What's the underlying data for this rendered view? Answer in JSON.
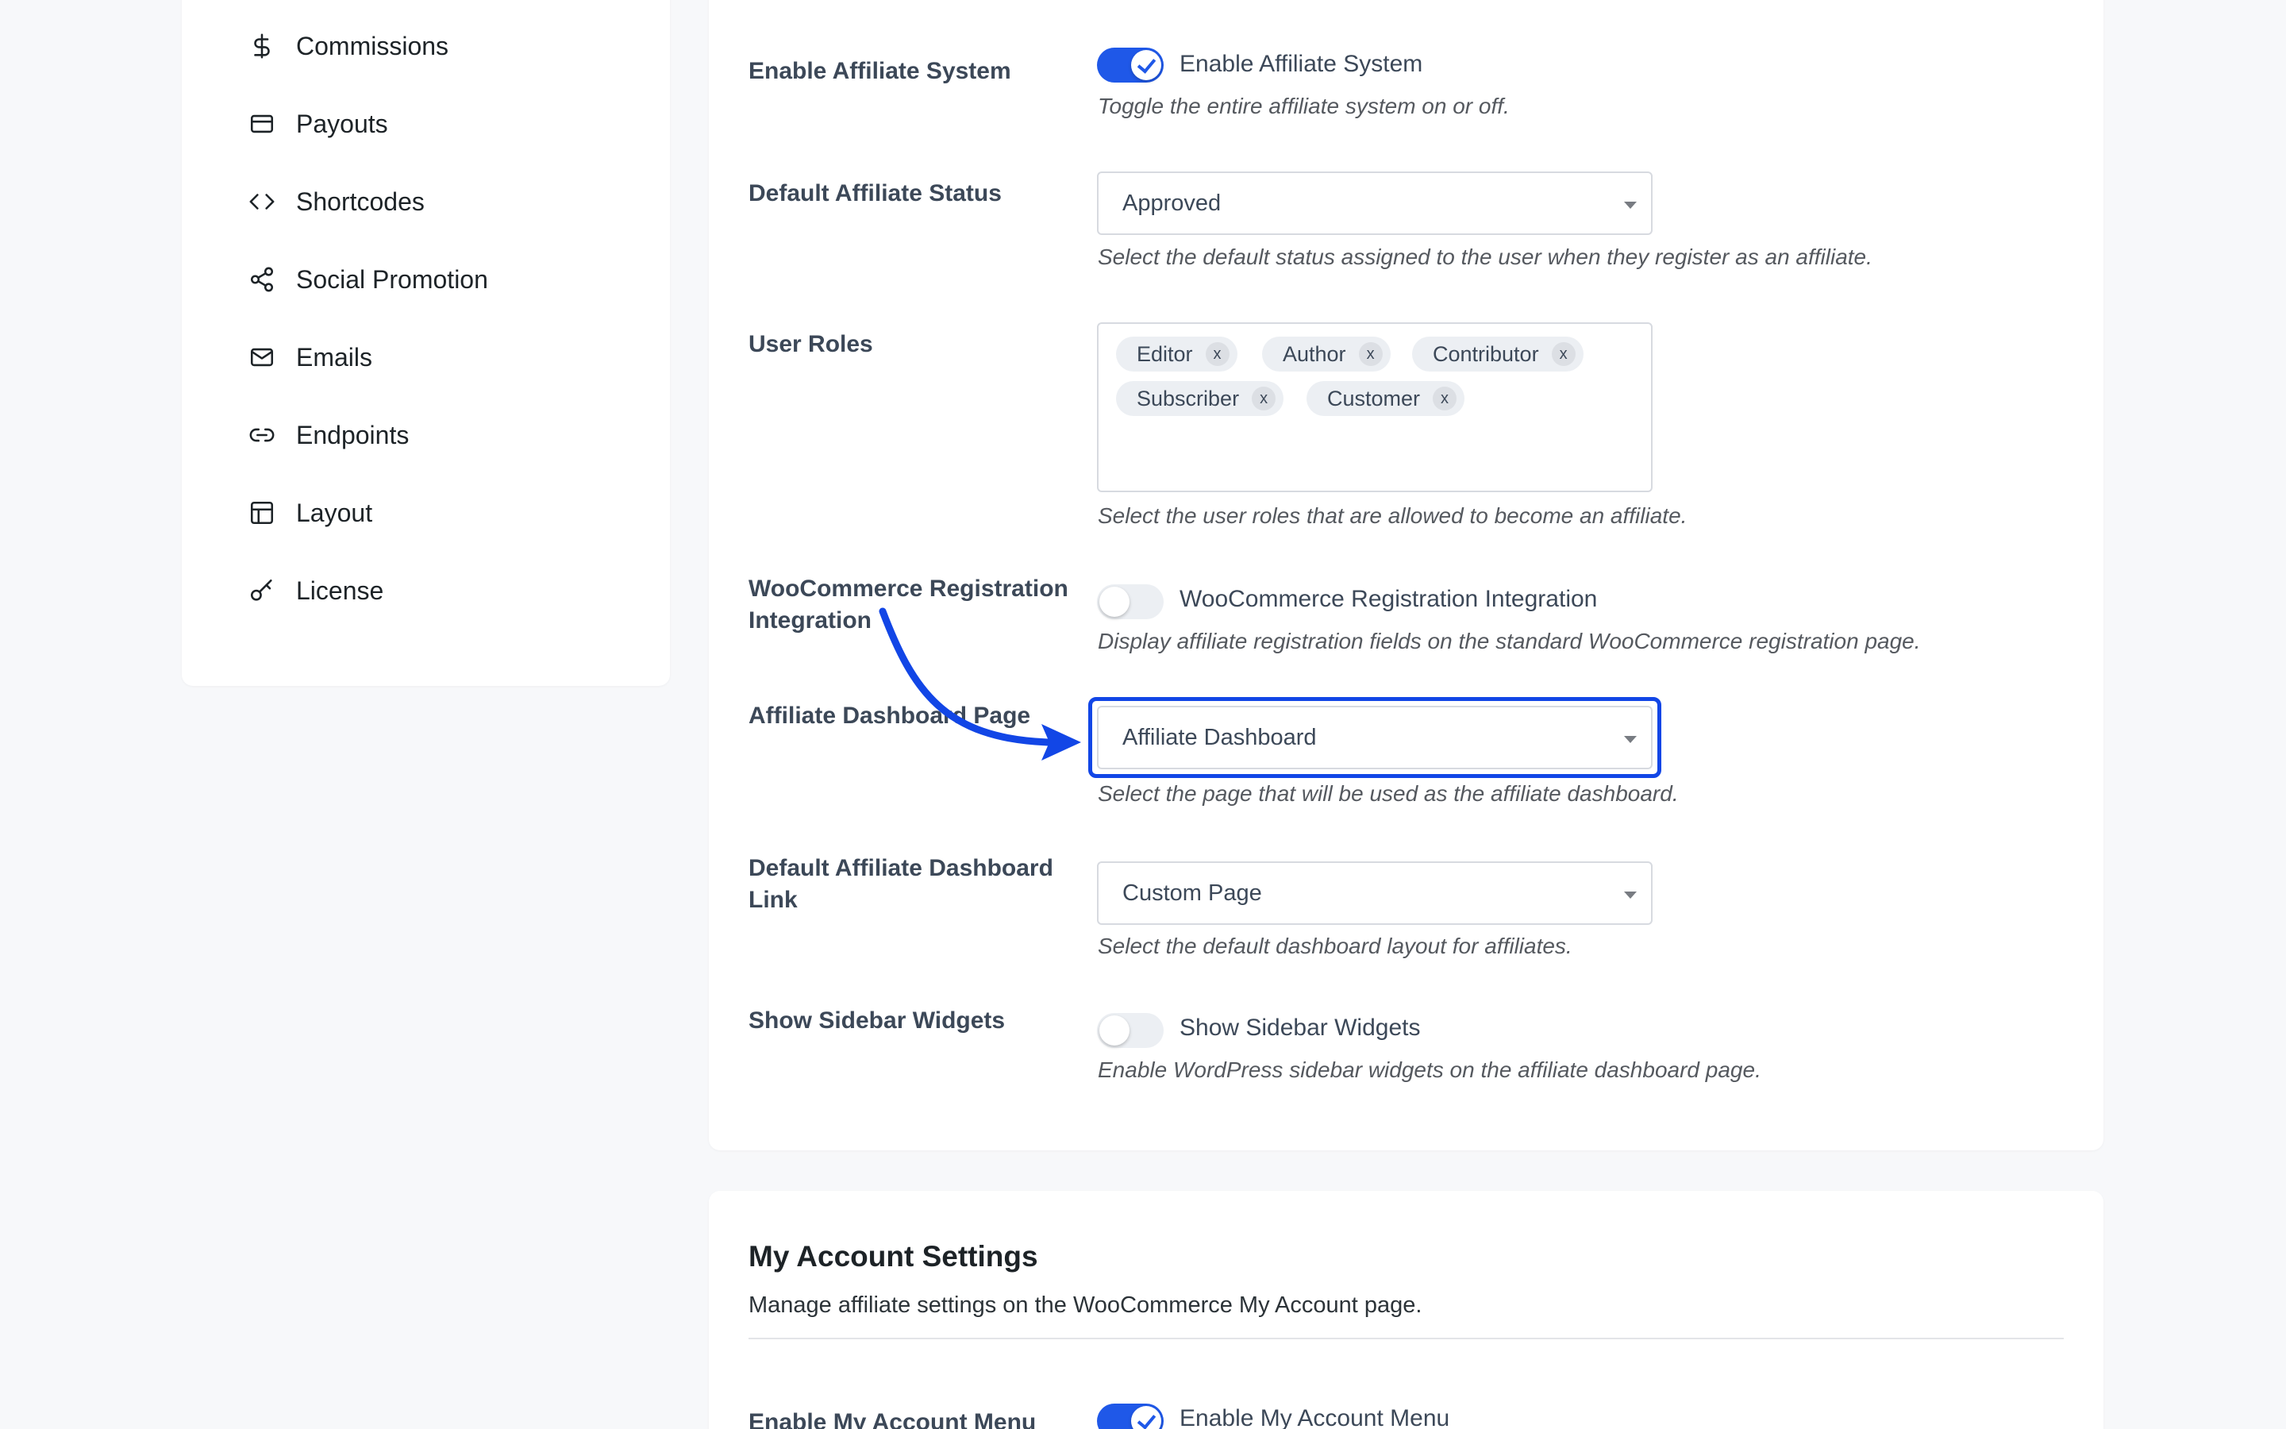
{
  "sidebar": {
    "items": [
      {
        "label": "Commissions",
        "icon": "dollar-icon"
      },
      {
        "label": "Payouts",
        "icon": "credit-card-icon"
      },
      {
        "label": "Shortcodes",
        "icon": "code-icon"
      },
      {
        "label": "Social Promotion",
        "icon": "share-icon"
      },
      {
        "label": "Emails",
        "icon": "mail-icon"
      },
      {
        "label": "Endpoints",
        "icon": "link-icon"
      },
      {
        "label": "Layout",
        "icon": "layout-icon"
      },
      {
        "label": "License",
        "icon": "key-icon"
      }
    ]
  },
  "general": {
    "enable_affiliate": {
      "label": "Enable Affiliate System",
      "toggle_text": "Enable Affiliate System",
      "enabled": true,
      "desc": "Toggle the entire affiliate system on or off."
    },
    "default_status": {
      "label": "Default Affiliate Status",
      "value": "Approved",
      "desc": "Select the default status assigned to the user when they register as an affiliate."
    },
    "user_roles": {
      "label": "User Roles",
      "chips": [
        "Editor",
        "Author",
        "Contributor",
        "Subscriber",
        "Customer"
      ],
      "remove_symbol": "x",
      "desc": "Select the user roles that are allowed to become an affiliate."
    },
    "woo_registration": {
      "label": "WooCommerce Registration Integration",
      "toggle_text": "WooCommerce Registration Integration",
      "enabled": false,
      "desc": "Display affiliate registration fields on the standard WooCommerce registration page."
    },
    "dashboard_page": {
      "label": "Affiliate Dashboard Page",
      "value": "Affiliate Dashboard",
      "desc": "Select the page that will be used as the affiliate dashboard."
    },
    "default_dashboard_link": {
      "label": "Default Affiliate Dashboard Link",
      "value": "Custom Page",
      "desc": "Select the default dashboard layout for affiliates."
    },
    "sidebar_widgets": {
      "label": "Show Sidebar Widgets",
      "toggle_text": "Show Sidebar Widgets",
      "enabled": false,
      "desc": "Enable WordPress sidebar widgets on the affiliate dashboard page."
    }
  },
  "my_account": {
    "title": "My Account Settings",
    "desc": "Manage affiliate settings on the WooCommerce My Account page.",
    "enable_menu": {
      "label": "Enable My Account Menu",
      "toggle_text": "Enable My Account Menu",
      "enabled": true
    }
  },
  "colors": {
    "accent": "#1f58e8",
    "highlight": "#1246e6",
    "page_bg": "#f7f8fa"
  }
}
